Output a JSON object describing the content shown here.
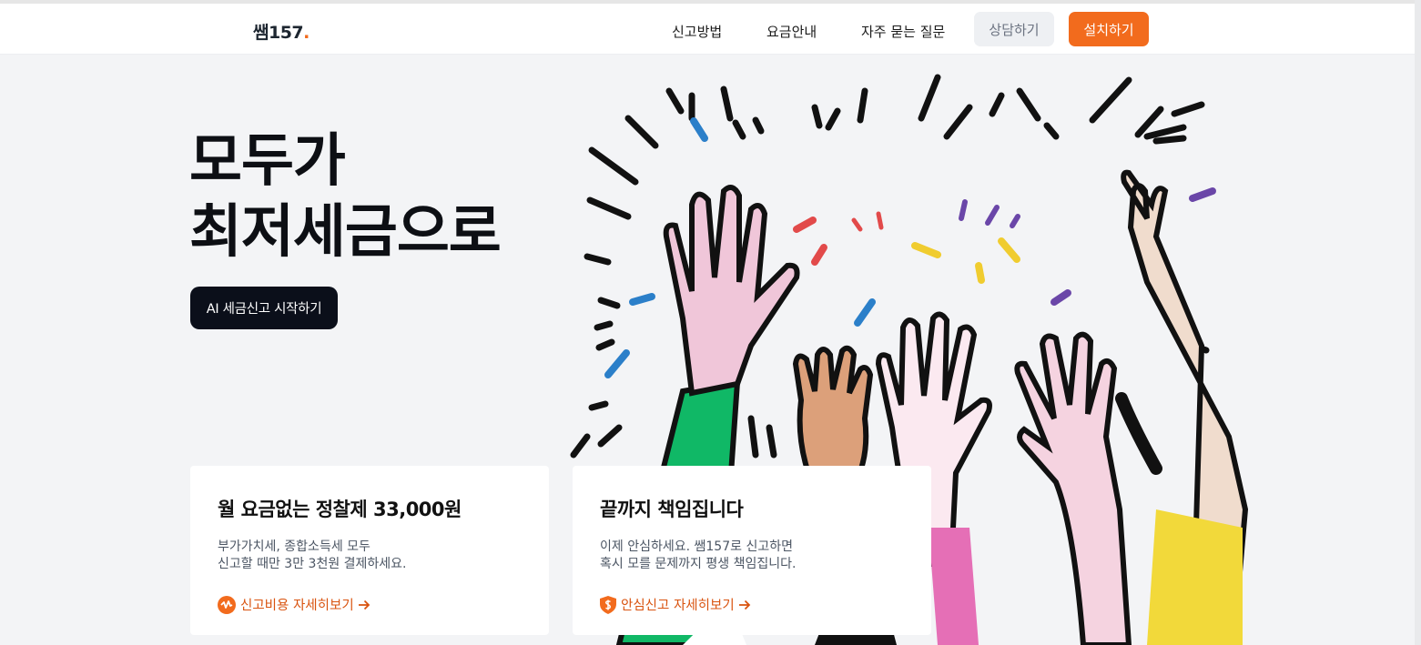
{
  "header": {
    "logo_text": "쌤157",
    "nav": [
      "신고방법",
      "요금안내",
      "자주 묻는 질문"
    ],
    "consult_label": "상담하기",
    "install_label": "설치하기"
  },
  "hero": {
    "title_line1": "모두가",
    "title_line2": "최저세금으로",
    "cta_label": "AI 세금신고 시작하기"
  },
  "cards": [
    {
      "title": "월 요금없는 정찰제 33,000원",
      "desc_line1": "부가가치세, 종합소득세 모두",
      "desc_line2": "신고할 때만 3만 3천원 결제하세요.",
      "link_label": "신고비용 자세히보기",
      "icon": "price-tag-icon"
    },
    {
      "title": "끝까지 책임집니다",
      "desc_line1": "이제 안심하세요. 쌤157로 신고하면",
      "desc_line2": "혹시 모를 문제까지 평생 책임집니다.",
      "link_label": "안심신고 자세히보기",
      "icon": "shield-icon"
    }
  ],
  "colors": {
    "accent": "#f26b1d",
    "dark": "#0b0f1a",
    "background": "#f3f4f6"
  }
}
